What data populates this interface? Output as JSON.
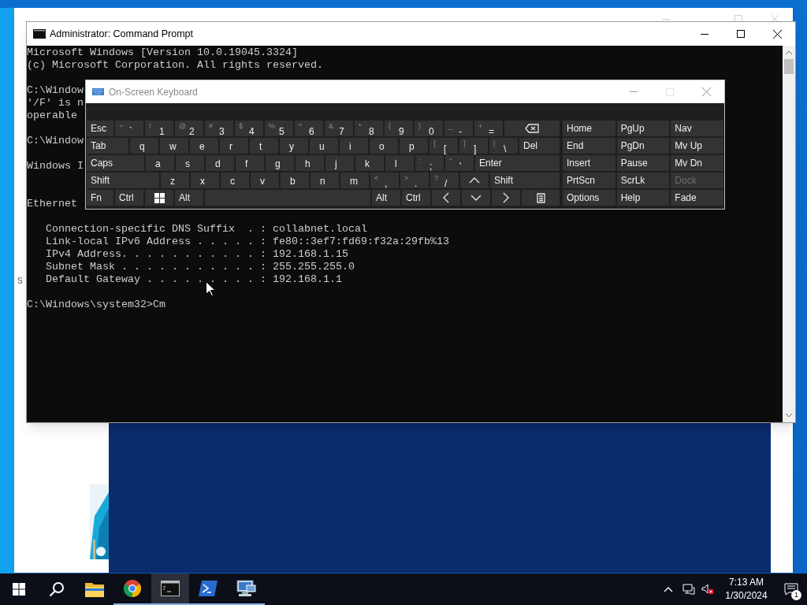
{
  "background_window": {
    "text": "S"
  },
  "console": {
    "title": "Administrator: Command Prompt",
    "paragraphs": [
      {
        "kind": "text",
        "lines": [
          "Microsoft Windows [Version 10.0.19045.3324]",
          "(c) Microsoft Corporation. All rights reserved."
        ]
      },
      {
        "kind": "text",
        "lines": [
          "C:\\Window",
          "'/F' is n",
          "operable"
        ]
      },
      {
        "kind": "text",
        "lines": [
          "C:\\Window"
        ]
      },
      {
        "kind": "text",
        "lines": [
          "Windows I"
        ]
      },
      {
        "kind": "section",
        "lines": [
          "Ethernet"
        ]
      },
      {
        "kind": "entries",
        "entries": [
          {
            "label": "Connection-specific DNS Suffix  . :",
            "value": "collabnet.local"
          },
          {
            "label": "Link-local IPv6 Address . . . . . :",
            "value": "fe80::3ef7:fd69:f32a:29fb%13"
          },
          {
            "label": "IPv4 Address. . . . . . . . . . . :",
            "value": "192.168.1.15"
          },
          {
            "label": "Subnet Mask . . . . . . . . . . . :",
            "value": "255.255.255.0"
          },
          {
            "label": "Default Gateway . . . . . . . . . :",
            "value": "192.168.1.1"
          }
        ]
      },
      {
        "kind": "text",
        "lines": [
          "C:\\Windows\\system32>Cm"
        ]
      }
    ]
  },
  "osk": {
    "title": "On-Screen Keyboard",
    "rows": [
      {
        "keys": [
          {
            "kind": "label",
            "label": "Esc"
          },
          {
            "kind": "char",
            "shift": "~",
            "char": "`"
          },
          {
            "kind": "char",
            "shift": "!",
            "char": "1"
          },
          {
            "kind": "char",
            "shift": "@",
            "char": "2"
          },
          {
            "kind": "char",
            "shift": "#",
            "char": "3"
          },
          {
            "kind": "char",
            "shift": "$",
            "char": "4"
          },
          {
            "kind": "char",
            "shift": "%",
            "char": "5"
          },
          {
            "kind": "char",
            "shift": "^",
            "char": "6"
          },
          {
            "kind": "char",
            "shift": "&",
            "char": "7"
          },
          {
            "kind": "char",
            "shift": "*",
            "char": "8"
          },
          {
            "kind": "char",
            "shift": "(",
            "char": "9"
          },
          {
            "kind": "char",
            "shift": ")",
            "char": "0"
          },
          {
            "kind": "char",
            "shift": "_",
            "char": "-"
          },
          {
            "kind": "char",
            "shift": "+",
            "char": "="
          },
          {
            "kind": "backspace"
          }
        ]
      },
      {
        "keys": [
          {
            "kind": "label",
            "label": "Tab"
          },
          {
            "kind": "char",
            "char": "q"
          },
          {
            "kind": "char",
            "char": "w"
          },
          {
            "kind": "char",
            "char": "e"
          },
          {
            "kind": "char",
            "char": "r"
          },
          {
            "kind": "char",
            "char": "t"
          },
          {
            "kind": "char",
            "char": "y"
          },
          {
            "kind": "char",
            "char": "u"
          },
          {
            "kind": "char",
            "char": "i"
          },
          {
            "kind": "char",
            "char": "o"
          },
          {
            "kind": "char",
            "char": "p"
          },
          {
            "kind": "char",
            "shift": "{",
            "char": "["
          },
          {
            "kind": "char",
            "shift": "}",
            "char": "]"
          },
          {
            "kind": "char",
            "shift": "|",
            "char": "\\"
          },
          {
            "kind": "label",
            "label": "Del"
          }
        ]
      },
      {
        "keys": [
          {
            "kind": "label",
            "label": "Caps"
          },
          {
            "kind": "char",
            "char": "a"
          },
          {
            "kind": "char",
            "char": "s"
          },
          {
            "kind": "char",
            "char": "d"
          },
          {
            "kind": "char",
            "char": "f"
          },
          {
            "kind": "char",
            "char": "g"
          },
          {
            "kind": "char",
            "char": "h"
          },
          {
            "kind": "char",
            "char": "j"
          },
          {
            "kind": "char",
            "char": "k"
          },
          {
            "kind": "char",
            "char": "l"
          },
          {
            "kind": "char",
            "shift": ":",
            "char": ";"
          },
          {
            "kind": "char",
            "shift": "\"",
            "char": "'"
          },
          {
            "kind": "label",
            "label": "Enter"
          }
        ]
      },
      {
        "keys": [
          {
            "kind": "label",
            "label": "Shift"
          },
          {
            "kind": "char",
            "char": "z"
          },
          {
            "kind": "char",
            "char": "x"
          },
          {
            "kind": "char",
            "char": "c"
          },
          {
            "kind": "char",
            "char": "v"
          },
          {
            "kind": "char",
            "char": "b"
          },
          {
            "kind": "char",
            "char": "n"
          },
          {
            "kind": "char",
            "char": "m"
          },
          {
            "kind": "char",
            "shift": "<",
            "char": ","
          },
          {
            "kind": "char",
            "shift": ">",
            "char": "."
          },
          {
            "kind": "char",
            "shift": "?",
            "char": "/"
          },
          {
            "kind": "up"
          },
          {
            "kind": "label",
            "label": "Shift"
          }
        ]
      },
      {
        "keys": [
          {
            "kind": "label",
            "label": "Fn"
          },
          {
            "kind": "label",
            "label": "Ctrl"
          },
          {
            "kind": "windows"
          },
          {
            "kind": "label",
            "label": "Alt"
          },
          {
            "kind": "space"
          },
          {
            "kind": "label",
            "label": "Alt"
          },
          {
            "kind": "label",
            "label": "Ctrl"
          },
          {
            "kind": "left"
          },
          {
            "kind": "down"
          },
          {
            "kind": "right"
          },
          {
            "kind": "menu"
          }
        ]
      }
    ],
    "nav_keys": [
      {
        "label": "Home",
        "disabled": false
      },
      {
        "label": "PgUp",
        "disabled": false
      },
      {
        "label": "Nav",
        "disabled": false
      },
      {
        "label": "End",
        "disabled": false
      },
      {
        "label": "PgDn",
        "disabled": false
      },
      {
        "label": "Mv Up",
        "disabled": false
      },
      {
        "label": "Insert",
        "disabled": false
      },
      {
        "label": "Pause",
        "disabled": false
      },
      {
        "label": "Mv Dn",
        "disabled": false
      },
      {
        "label": "PrtScn",
        "disabled": false
      },
      {
        "label": "ScrLk",
        "disabled": false
      },
      {
        "label": "Dock",
        "disabled": true
      },
      {
        "label": "Options",
        "disabled": false
      },
      {
        "label": "Help",
        "disabled": false
      },
      {
        "label": "Fade",
        "disabled": false
      }
    ]
  },
  "taskbar": {
    "apps": [
      {
        "kind": "folder",
        "running": false,
        "selected": false
      },
      {
        "kind": "chrome",
        "running": true,
        "selected": false
      },
      {
        "kind": "console",
        "running": true,
        "selected": true
      },
      {
        "kind": "powershell",
        "running": true,
        "selected": false
      },
      {
        "kind": "remote",
        "running": true,
        "selected": false
      }
    ],
    "time": "7:13 AM",
    "date": "1/30/2024",
    "notification_count": "1"
  }
}
